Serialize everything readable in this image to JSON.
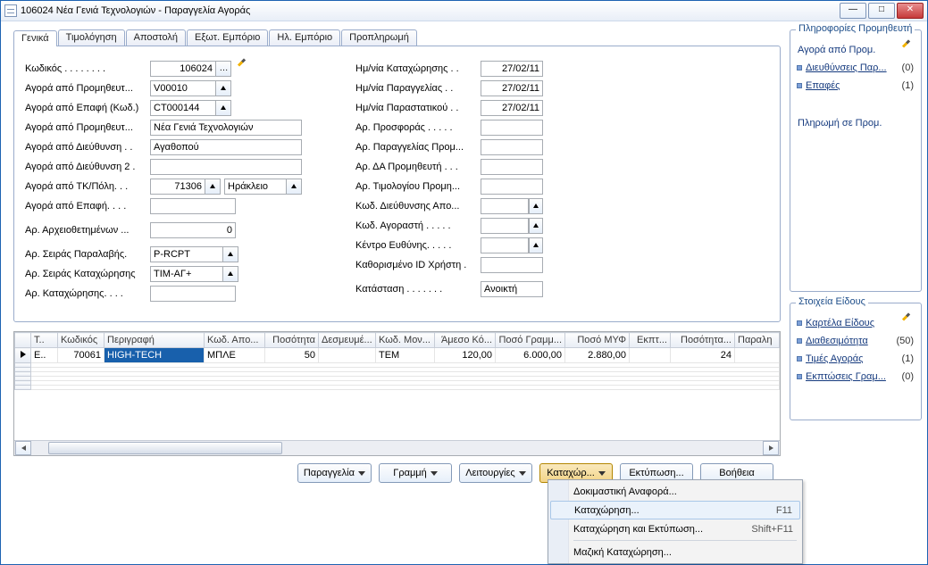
{
  "window": {
    "title": "106024 Νέα Γενιά Τεχνολογιών - Παραγγελία Αγοράς"
  },
  "tabs": [
    "Γενικά",
    "Τιμολόγηση",
    "Αποστολή",
    "Εξωτ. Εμπόριο",
    "Ηλ. Εμπόριο",
    "Προπληρωμή"
  ],
  "form_left": {
    "code_label": "Κωδικός . . . . . . . .",
    "code_value": "106024",
    "vendor_label": "Αγορά από Προμηθευτ...",
    "vendor_value": "V00010",
    "contact_code_label": "Αγορά από Επαφή (Κωδ.)",
    "contact_code_value": "CT000144",
    "vendor_name_label": "Αγορά από Προμηθευτ...",
    "vendor_name_value": "Νέα Γενιά Τεχνολογιών",
    "address_label": "Αγορά από Διεύθυνση . .",
    "address_value": "Αγαθοπού",
    "address2_label": "Αγορά από Διεύθυνση 2 .",
    "address2_value": "",
    "zip_city_label": "Αγορά από ΤΚ/Πόλη. . .",
    "zip_value": "71306",
    "city_value": "Ηράκλειο",
    "contact_label": "Αγορά από Επαφή. . . .",
    "contact_value": "",
    "arch_label": "Αρ. Αρχειοθετημένων ...",
    "arch_value": "0",
    "series_receipt_label": "Αρ. Σειράς Παραλαβής.",
    "series_receipt_value": "P-RCPT",
    "series_post_label": "Αρ. Σειράς Καταχώρησης",
    "series_post_value": "ΤΙΜ-ΑΓ+",
    "post_no_label": "Αρ. Καταχώρησης. . . .",
    "post_no_value": ""
  },
  "form_right": {
    "entry_date_label": "Ημ/νία Καταχώρησης . .",
    "entry_date_value": "27/02/11",
    "order_date_label": "Ημ/νία Παραγγελίας . .",
    "order_date_value": "27/02/11",
    "doc_date_label": "Ημ/νία Παραστατικού  . .",
    "doc_date_value": "27/02/11",
    "quote_no_label": "Αρ. Προσφοράς . . . . .",
    "vendor_order_no_label": "Αρ. Παραγγελίας Προμ...",
    "vendor_shipment_no_label": "Αρ. ΔΑ Προμηθευτή . . .",
    "vendor_invoice_no_label": "Αρ. Τιμολογίου Προμη...",
    "ship_code_label": "Κωδ. Διεύθυνσης Απο...",
    "purchaser_code_label": "Κωδ. Αγοραστή . . . . .",
    "resp_center_label": "Κέντρο Ευθύνης. . . . .",
    "user_id_label": "Καθορισμένο ID Χρήστη .",
    "status_label": "Κατάσταση . . . . . . .",
    "status_value": "Ανοικτή"
  },
  "grid": {
    "headers": [
      "Τ..",
      "Κωδικός",
      "Περιγραφή",
      "Κωδ. Απο...",
      "Ποσότητα",
      "Δεσμευμέ...",
      "Κωδ. Μον...",
      "Άμεσο Κό...",
      "Ποσό Γραμμ...",
      "Ποσό ΜΥΦ",
      "Εκπτ...",
      "Ποσότητα...",
      "Παραλη"
    ],
    "row": {
      "type": "Ε..",
      "code": "70061",
      "desc": "HIGH-TECH",
      "apo": "ΜΠΛΕ",
      "qty": "50",
      "reserved": "",
      "uom": "TEM",
      "direct": "120,00",
      "line_amount": "6.000,00",
      "myf": "2.880,00",
      "disc": "",
      "qty_rcv": "24",
      "recvd": ""
    }
  },
  "actions": {
    "order": "Παραγγελία",
    "line": "Γραμμή",
    "functions": "Λειτουργίες",
    "post": "Καταχώρ...",
    "print": "Εκτύπωση...",
    "help": "Βοήθεια"
  },
  "menu": {
    "test_report": "Δοκιμαστική Αναφορά...",
    "post": "Καταχώρηση...",
    "post_sc": "F11",
    "post_print": "Καταχώρηση και Εκτύπωση...",
    "post_print_sc": "Shift+F11",
    "batch_post": "Μαζική Καταχώρηση..."
  },
  "rp_vendor": {
    "title": "Πληροφορίες Προμηθευτή",
    "buy_from": "Αγορά από Προμ.",
    "addresses": "Διευθύνσεις Παρ...",
    "addresses_cnt": "(0)",
    "contacts": "Επαφές",
    "contacts_cnt": "(1)",
    "pay_to": "Πληρωμή σε Προμ."
  },
  "rp_item": {
    "title": "Στοιχεία Είδους",
    "card": "Καρτέλα Είδους",
    "availability": "Διαθεσιμότητα",
    "availability_cnt": "(50)",
    "prices": "Τιμές Αγοράς",
    "prices_cnt": "(1)",
    "discounts": "Εκπτώσεις Γραμ...",
    "discounts_cnt": "(0)"
  }
}
